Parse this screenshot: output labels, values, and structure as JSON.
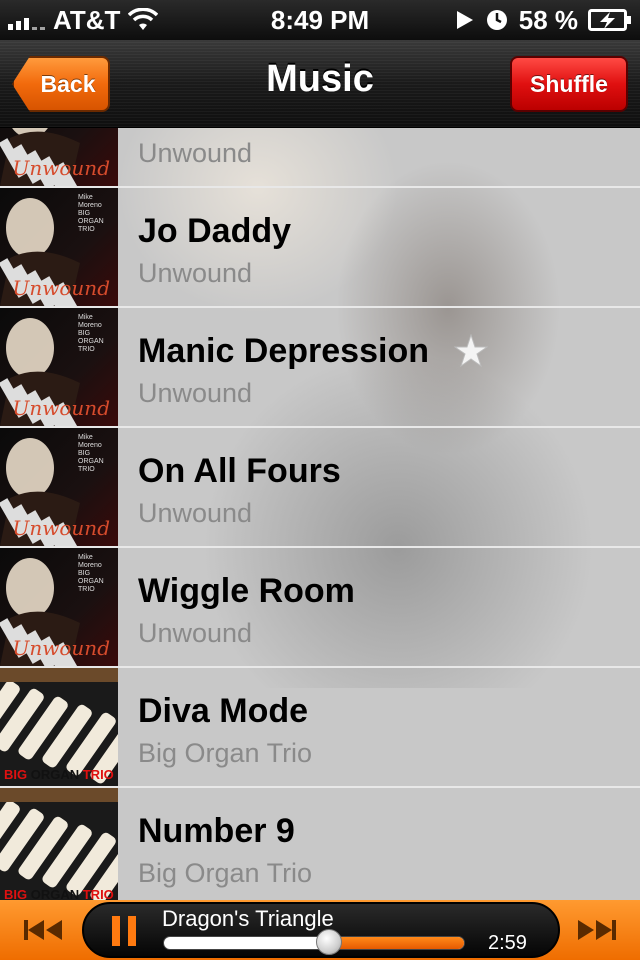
{
  "status_bar": {
    "carrier": "AT&T",
    "time": "8:49 PM",
    "battery": "58 %"
  },
  "nav": {
    "title": "Music",
    "back_label": "Back",
    "shuffle_label": "Shuffle"
  },
  "songs": [
    {
      "title": "",
      "artist": "Unwound",
      "art": "unwound"
    },
    {
      "title": "Jo Daddy",
      "artist": "Unwound",
      "art": "unwound"
    },
    {
      "title": "Manic Depression",
      "artist": "Unwound",
      "art": "unwound"
    },
    {
      "title": "On All Fours",
      "artist": "Unwound",
      "art": "unwound"
    },
    {
      "title": "Wiggle Room",
      "artist": "Unwound",
      "art": "unwound"
    },
    {
      "title": "Diva Mode",
      "artist": "Big Organ Trio",
      "art": "organ"
    },
    {
      "title": "Number 9",
      "artist": "Big Organ Trio",
      "art": "organ"
    }
  ],
  "album_art_text": {
    "unwound": "Unwound",
    "organ_big": "BIG",
    "organ_organ": "ORGAN",
    "organ_trio": "TRIO",
    "mini_credit": "Mike Moreno BIG ORGAN TRIO"
  },
  "now_playing": {
    "track": "Dragon's Triangle",
    "elapsed": "2:59",
    "progress": 0.55
  },
  "colors": {
    "accent_orange": "#f26a0c",
    "shuffle_red": "#e01010",
    "artist_gray": "#8a8a8a"
  }
}
